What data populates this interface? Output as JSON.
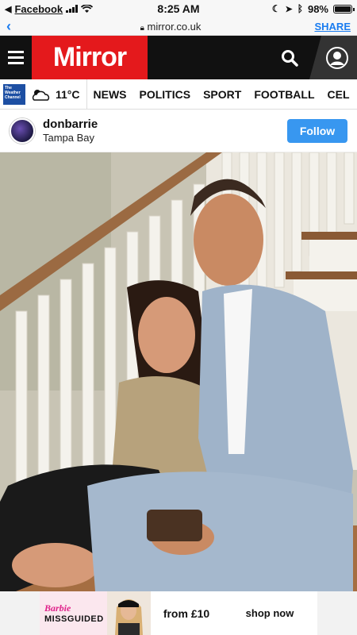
{
  "status_bar": {
    "back_app": "Facebook",
    "time": "8:25 AM",
    "battery": "98%",
    "battery_level": 0.98
  },
  "url_bar": {
    "url": "mirror.co.uk",
    "share_label": "SHARE"
  },
  "header": {
    "logo_text": "Mirror"
  },
  "nav": {
    "weather_badge": [
      "The",
      "Weather",
      "Channel"
    ],
    "temperature": "11°C",
    "items": [
      "NEWS",
      "POLITICS",
      "SPORT",
      "FOOTBALL",
      "CEL"
    ]
  },
  "instagram": {
    "username": "donbarrie",
    "location": "Tampa Bay",
    "follow_label": "Follow"
  },
  "ad": {
    "brand_line1": "Barbie",
    "brand_line2": "MISSGUIDED",
    "price": "from £10",
    "cta": "shop now"
  },
  "colors": {
    "brand_red": "#e4191c",
    "follow_blue": "#3897f0",
    "ios_blue": "#1a7cf0"
  }
}
